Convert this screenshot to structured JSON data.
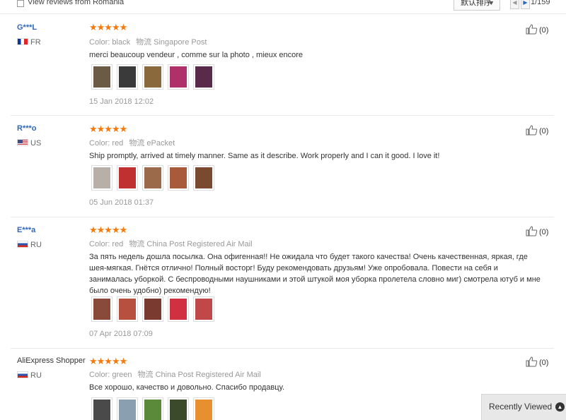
{
  "topbar": {
    "view_romania_label": "View reviews from Romania",
    "sort_label": "默认排序",
    "page_indicator": "1/159"
  },
  "reviews": [
    {
      "user": "G***L",
      "country": "FR",
      "color_label": "Color:",
      "color_value": "black",
      "shipping_label": "物流",
      "shipping_value": "Singapore Post",
      "feedback": "merci beaucoup vendeur , comme sur la photo , mieux encore",
      "photos": [
        "#6b5a44",
        "#3a3a3a",
        "#8a6a3c",
        "#b0306a",
        "#5a2a4a"
      ],
      "date": "15 Jan 2018 12:02",
      "helpful": "(0)",
      "rating": 5
    },
    {
      "user": "R***o",
      "country": "US",
      "color_label": "Color:",
      "color_value": "red",
      "shipping_label": "物流",
      "shipping_value": "ePacket",
      "feedback": "Ship promptly, arrived at timely manner. Same as it describe. Work properly and I can it good. I love it!",
      "photos": [
        "#b8b0a8",
        "#c03030",
        "#9a6a4a",
        "#a85a3a",
        "#7a4a30"
      ],
      "date": "05 Jun 2018 01:37",
      "helpful": "(0)",
      "rating": 5
    },
    {
      "user": "E***a",
      "country": "RU",
      "color_label": "Color:",
      "color_value": "red",
      "shipping_label": "物流",
      "shipping_value": "China Post Registered Air Mail",
      "feedback": "За пять недель дошла посылка. Она офигенная!! Не ожидала что будет такого качества! Очень качественная, яркая, где шея-мягкая. Гнётся отлично! Полный восторг! Буду рекомендовать друзьям! Уже опробовала. Повести на себя и занималась уборкой. С беспроводными наушниками и этой штукой моя уборка пролетела словно миг) смотрела ютуб и мне было очень удобно) рекомендую!",
      "photos": [
        "#8a4a3a",
        "#b85040",
        "#7a3a30",
        "#d03040",
        "#c04848"
      ],
      "date": "07 Apr 2018 07:09",
      "helpful": "(0)",
      "rating": 5
    },
    {
      "user": "AliExpress Shopper",
      "country": "RU",
      "color_label": "Color:",
      "color_value": "green",
      "shipping_label": "物流",
      "shipping_value": "China Post Registered Air Mail",
      "feedback": "Все хорошо, качество и довольно. Спасибо продавцу.",
      "photos": [
        "#4a4a4a",
        "#8aa0b0",
        "#5a8a3a",
        "#3a4a2a",
        "#e89030"
      ],
      "date": "",
      "helpful": "(0)",
      "rating": 5
    }
  ],
  "recently_viewed": {
    "label": "Recently Viewed"
  },
  "colors": {
    "accent_link": "#2f68b6",
    "star": "#f47a0e"
  }
}
